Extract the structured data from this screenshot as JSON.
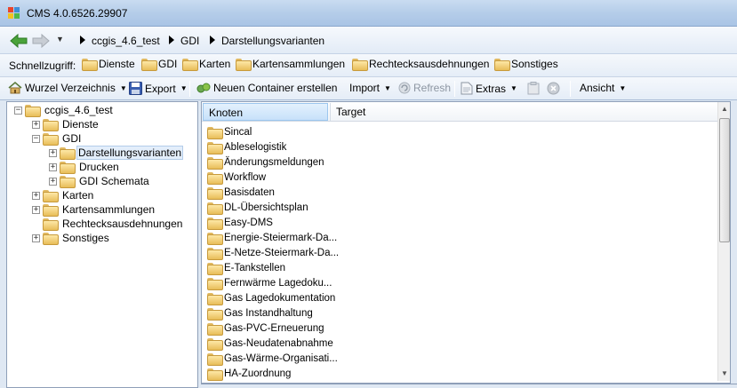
{
  "window": {
    "title": "CMS 4.0.6526.29907"
  },
  "address": {
    "breadcrumb": [
      "ccgis_4.6_test",
      "GDI",
      "Darstellungsvarianten"
    ]
  },
  "quickaccess": {
    "label": "Schnellzugriff:",
    "items": [
      "Dienste",
      "GDI",
      "Karten",
      "Kartensammlungen",
      "Rechtecksausdehnungen",
      "Sonstiges"
    ]
  },
  "toolbar": {
    "root_dir": "Wurzel Verzeichnis",
    "export": "Export",
    "new_container": "Neuen Container erstellen",
    "import": "Import",
    "refresh": "Refresh",
    "extras": "Extras",
    "view": "Ansicht"
  },
  "tree": {
    "root": "ccgis_4.6_test",
    "items": [
      {
        "label": "Dienste",
        "expander": "+"
      },
      {
        "label": "GDI",
        "expander": "−"
      },
      {
        "label": "Darstellungsvarianten",
        "expander": "+",
        "selected": true
      },
      {
        "label": "Drucken",
        "expander": "+"
      },
      {
        "label": "GDI Schemata",
        "expander": "+"
      },
      {
        "label": "Karten",
        "expander": "+"
      },
      {
        "label": "Kartensammlungen",
        "expander": "+"
      },
      {
        "label": "Rechtecksausdehnungen",
        "expander": ""
      },
      {
        "label": "Sonstiges",
        "expander": "+"
      }
    ]
  },
  "list": {
    "columns": [
      "Knoten",
      "Target"
    ],
    "rows": [
      "Sincal",
      "Ableselogistik",
      "Änderungsmeldungen",
      "Workflow",
      "Basisdaten",
      "DL-Übersichtsplan",
      "Easy-DMS",
      "Energie-Steiermark-Da...",
      "E-Netze-Steiermark-Da...",
      "E-Tankstellen",
      "Fernwärme Lagedoku...",
      "Gas Lagedokumentation",
      "Gas Instandhaltung",
      "Gas-PVC-Erneuerung",
      "Gas-Neudatenabnahme",
      "Gas-Wärme-Organisati...",
      "HA-Zuordnung"
    ]
  },
  "colors": {
    "titlebar": "#b5cde9",
    "selection": "#e3eefb",
    "folder": "#e8bd58"
  }
}
